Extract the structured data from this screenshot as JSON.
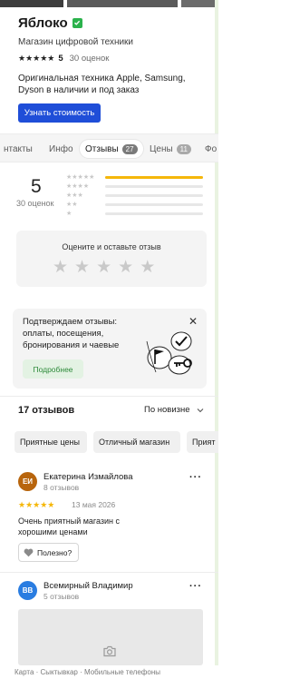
{
  "header": {
    "title": "Яблоко",
    "subtitle": "Магазин цифровой техники",
    "rating_stars": "★★★★★",
    "rating_value": "5",
    "rating_count": "30 оценок",
    "description": "Оригинальная техника Apple, Samsung, Dyson в наличии и под заказ",
    "cta_label": "Узнать стоимость"
  },
  "tabs": [
    {
      "label": "нтакты"
    },
    {
      "label": "Инфо"
    },
    {
      "label": "Отзывы",
      "badge": "27"
    },
    {
      "label": "Цены",
      "badge": "11"
    },
    {
      "label": "Фо"
    }
  ],
  "summary": {
    "score": "5",
    "reviews_count": "30 оценок",
    "distribution": [
      {
        "stars": "★★★★★",
        "share": 1.0
      },
      {
        "stars": "★★★★",
        "share": 0.0
      },
      {
        "stars": "★★★",
        "share": 0.0
      },
      {
        "stars": "★★",
        "share": 0.0
      },
      {
        "stars": "★",
        "share": 0.0
      }
    ]
  },
  "rate_box": {
    "label": "Оцените и оставьте отзыв",
    "stars": [
      "★",
      "★",
      "★",
      "★",
      "★"
    ]
  },
  "promo": {
    "text": "Подтверждаем отзывы: оплаты, посещения, бронирования и чаевые",
    "button_label": "Подробнее",
    "close_glyph": "✕"
  },
  "reviews_list": {
    "count_label": "17 отзывов",
    "sort_label": "По новизне",
    "chips": [
      "Приятные цены",
      "Отличный магазин",
      "Прият"
    ]
  },
  "reviews": [
    {
      "initials": "ЕИ",
      "avatar_color": "#b8650d",
      "name": "Екатерина Измайлова",
      "sub": "8 отзывов",
      "stars": "★★★★★",
      "date": "13 мая 2026",
      "text": "Очень приятный магазин с хорошими ценами",
      "useful_label": "Полезно?"
    },
    {
      "initials": "ВВ",
      "avatar_color": "#2a7de1",
      "name": "Всемирный Владимир",
      "sub": "5 отзывов"
    }
  ],
  "breadcrumbs": "Карта · Сыктывкар · Мобильные телефоны"
}
